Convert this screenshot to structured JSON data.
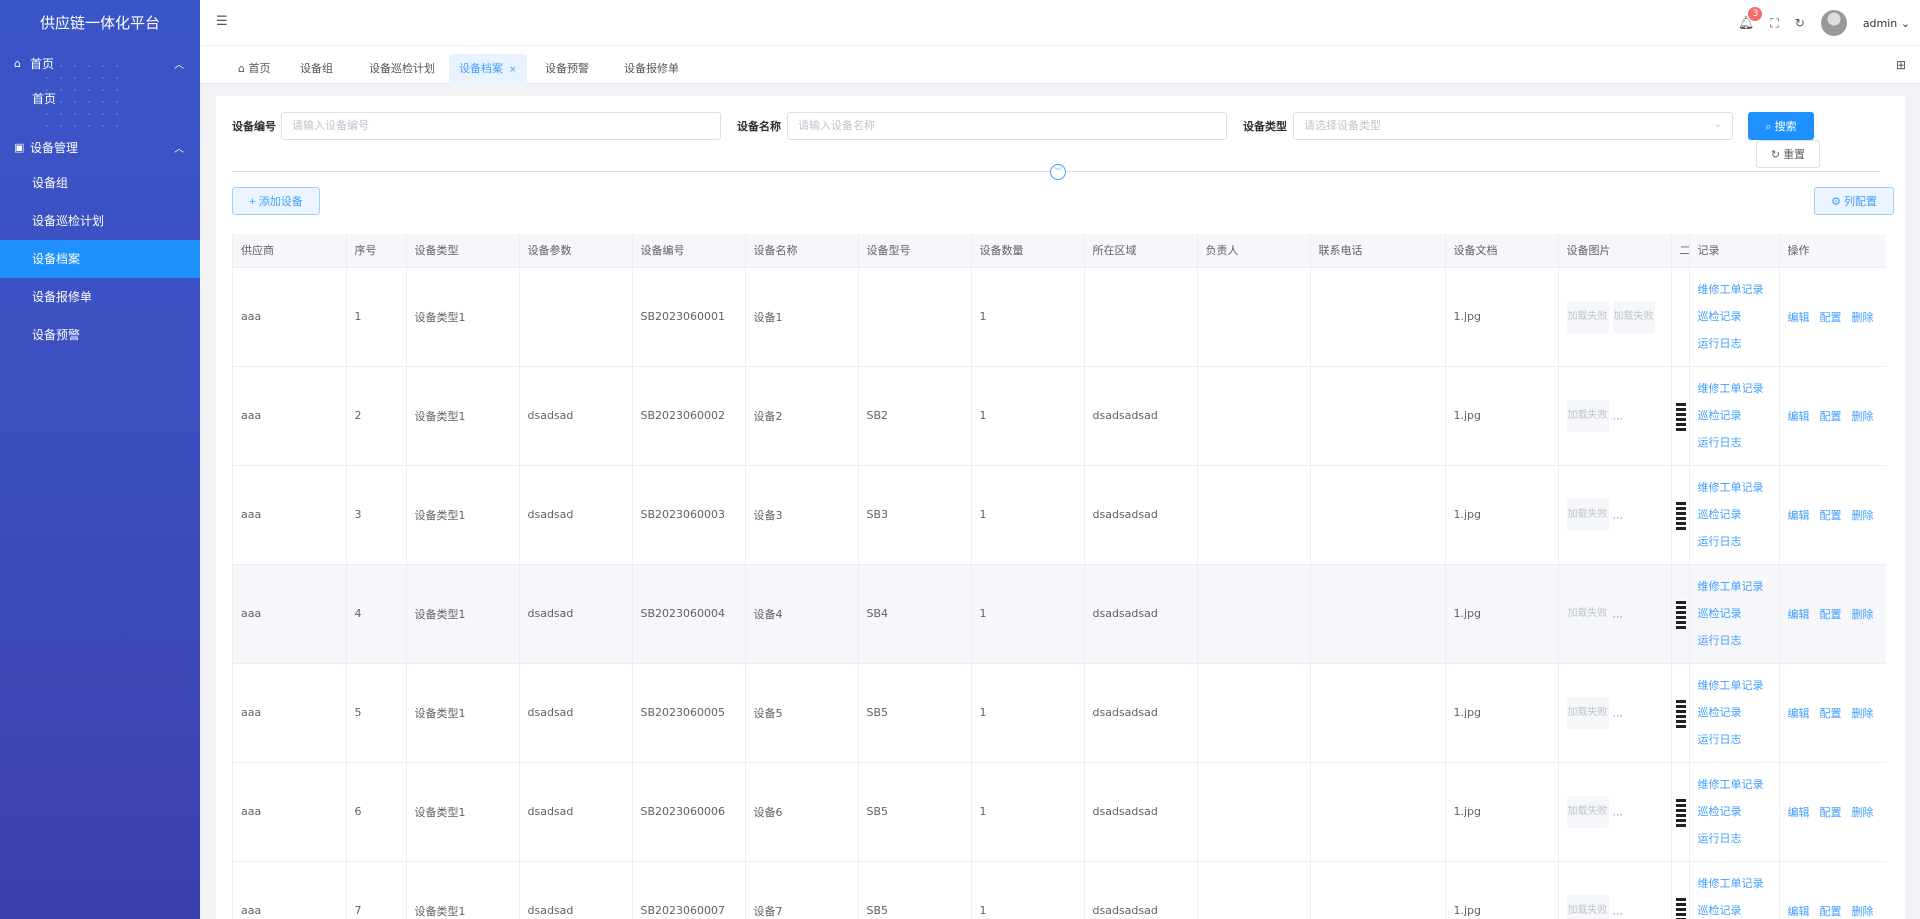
{
  "app": {
    "title": "供应链一体化平台"
  },
  "sidebar": {
    "groups": [
      {
        "label": "首页",
        "icon": "home-icon",
        "items": [
          "首页"
        ]
      },
      {
        "label": "设备管理",
        "icon": "message-icon",
        "items": [
          "设备组",
          "设备巡检计划",
          "设备档案",
          "设备报修单",
          "设备预警"
        ]
      }
    ],
    "active_item": "设备档案"
  },
  "header": {
    "notification_count": "3",
    "username": "admin"
  },
  "tabs": [
    {
      "label": "首页",
      "active": false
    },
    {
      "label": "设备组",
      "active": false
    },
    {
      "label": "设备巡检计划",
      "active": false
    },
    {
      "label": "设备档案",
      "active": true,
      "close": "×"
    },
    {
      "label": "设备预警",
      "active": false
    },
    {
      "label": "设备报修单",
      "active": false
    }
  ],
  "search": {
    "code_label": "设备编号",
    "code_placeholder": "请输入设备编号",
    "name_label": "设备名称",
    "name_placeholder": "请输入设备名称",
    "type_label": "设备类型",
    "type_placeholder": "请选择设备类型",
    "search_btn": "搜索",
    "reset_btn": "重置"
  },
  "toolbar": {
    "add_btn": "添加设备",
    "columns_btn": "列配置"
  },
  "table": {
    "headers": [
      "供应商",
      "序号",
      "设备类型",
      "设备参数",
      "设备编号",
      "设备名称",
      "设备型号",
      "设备数量",
      "所在区域",
      "负责人",
      "联系电话",
      "设备文档",
      "设备图片",
      "二",
      "记录",
      "操作"
    ],
    "img_fail": "加载失败",
    "ellipsis": "...",
    "record_links": [
      "维修工单记录",
      "巡检记录",
      "运行日志"
    ],
    "ops": [
      "编辑",
      "配置",
      "删除"
    ],
    "rows": [
      {
        "supplier": "aaa",
        "no": "1",
        "type": "设备类型1",
        "param": "",
        "code": "SB2023060001",
        "name": "设备1",
        "model": "",
        "qty": "1",
        "area": "",
        "owner": "",
        "phone": "",
        "doc": "1.jpg",
        "imgs": 2
      },
      {
        "supplier": "aaa",
        "no": "2",
        "type": "设备类型1",
        "param": "dsadsad",
        "code": "SB2023060002",
        "name": "设备2",
        "model": "SB2",
        "qty": "1",
        "area": "dsadsadsad",
        "owner": "",
        "phone": "",
        "doc": "1.jpg",
        "imgs": 1
      },
      {
        "supplier": "aaa",
        "no": "3",
        "type": "设备类型1",
        "param": "dsadsad",
        "code": "SB2023060003",
        "name": "设备3",
        "model": "SB3",
        "qty": "1",
        "area": "dsadsadsad",
        "owner": "",
        "phone": "",
        "doc": "1.jpg",
        "imgs": 1
      },
      {
        "supplier": "aaa",
        "no": "4",
        "type": "设备类型1",
        "param": "dsadsad",
        "code": "SB2023060004",
        "name": "设备4",
        "model": "SB4",
        "qty": "1",
        "area": "dsadsadsad",
        "owner": "",
        "phone": "",
        "doc": "1.jpg",
        "imgs": 1,
        "highlight": true
      },
      {
        "supplier": "aaa",
        "no": "5",
        "type": "设备类型1",
        "param": "dsadsad",
        "code": "SB2023060005",
        "name": "设备5",
        "model": "SB5",
        "qty": "1",
        "area": "dsadsadsad",
        "owner": "",
        "phone": "",
        "doc": "1.jpg",
        "imgs": 1
      },
      {
        "supplier": "aaa",
        "no": "6",
        "type": "设备类型1",
        "param": "dsadsad",
        "code": "SB2023060006",
        "name": "设备6",
        "model": "SB5",
        "qty": "1",
        "area": "dsadsadsad",
        "owner": "",
        "phone": "",
        "doc": "1.jpg",
        "imgs": 1
      },
      {
        "supplier": "aaa",
        "no": "7",
        "type": "设备类型1",
        "param": "dsadsad",
        "code": "SB2023060007",
        "name": "设备7",
        "model": "SB5",
        "qty": "1",
        "area": "dsadsadsad",
        "owner": "",
        "phone": "",
        "doc": "1.jpg",
        "imgs": 1
      }
    ]
  },
  "colors": {
    "sidebar": "#3d4fc0",
    "active": "#1f90ff",
    "link": "#409eff"
  }
}
